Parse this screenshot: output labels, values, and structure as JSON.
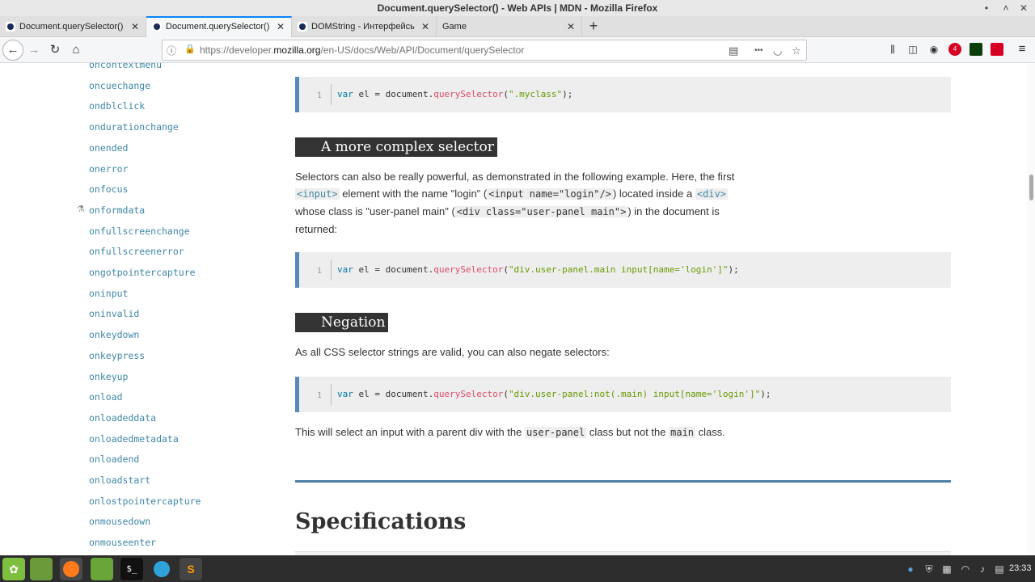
{
  "window": {
    "title": "Document.querySelector() - Web APIs | MDN - Mozilla Firefox",
    "minimize": "•",
    "maximize": "˄",
    "close": "✕"
  },
  "tabs": [
    {
      "label": "Document.querySelector()",
      "close": "✕"
    },
    {
      "label": "Document.querySelector()",
      "close": "✕"
    },
    {
      "label": "DOMString - Интерфейсы",
      "close": "✕"
    },
    {
      "label": "Game",
      "close": "✕"
    }
  ],
  "new_tab": "+",
  "nav": {
    "back": "←",
    "forward": "→",
    "reload": "↻",
    "home": "⌂",
    "url_prefix": "https://developer.",
    "url_domain": "mozilla.org",
    "url_path": "/en-US/docs/Web/API/Document/querySelector",
    "reader": "▤",
    "more": "•••",
    "pocket": "◡",
    "bookmark": "☆"
  },
  "toolbar": {
    "library": "⫼",
    "sidebar": "◫",
    "account": "◉",
    "ext_badge": "4",
    "menu": "≡"
  },
  "sidebar": {
    "items": [
      "oncontextmenu",
      "oncuechange",
      "ondblclick",
      "ondurationchange",
      "onended",
      "onerror",
      "onfocus",
      "onformdata",
      "onfullscreenchange",
      "onfullscreenerror",
      "ongotpointercapture",
      "oninput",
      "oninvalid",
      "onkeydown",
      "onkeypress",
      "onkeyup",
      "onload",
      "onloadeddata",
      "onloadedmetadata",
      "onloadend",
      "onloadstart",
      "onlostpointercapture",
      "onmousedown",
      "onmouseenter"
    ],
    "flask_icon": "⚗"
  },
  "main": {
    "code1": {
      "ln": "1",
      "kw": "var",
      "rest": " el = document.",
      "fn": "querySelector",
      "open": "(",
      "str": "\".myclass\"",
      "close": ");"
    },
    "heading1": "A more complex selector",
    "para1": {
      "t1": "Selectors can also be really powerful, as demonstrated in the following example. Here, the first ",
      "c1": "<input>",
      "t2": " element with the name \"login\" (",
      "c2": "<input name=\"login\"/>",
      "t3": ") located inside a ",
      "c3": "<div>",
      "t4": " whose class is \"user-panel main\" (",
      "c4": "<div class=\"user-panel main\">",
      "t5": ") in the document is returned:"
    },
    "code2": {
      "ln": "1",
      "kw": "var",
      "rest": " el = document.",
      "fn": "querySelector",
      "open": "(",
      "str": "\"div.user-panel.main input[name='login']\"",
      "close": ");"
    },
    "heading2": "Negation",
    "para2": "As all CSS selector strings are valid, you can also negate selectors:",
    "code3": {
      "ln": "1",
      "kw": "var",
      "rest": " el = document.",
      "fn": "querySelector",
      "open": "(",
      "str": "\"div.user-panel:not(.main) input[name='login']\"",
      "close": ");"
    },
    "para3": {
      "t1": "This will select an input with a parent div with the ",
      "c1": "user-panel",
      "t2": " class but not the ",
      "c2": "main",
      "t3": " class."
    },
    "heading3": "Specifications"
  },
  "taskbar": {
    "menu_icon": "✿",
    "clock": "23:33"
  }
}
